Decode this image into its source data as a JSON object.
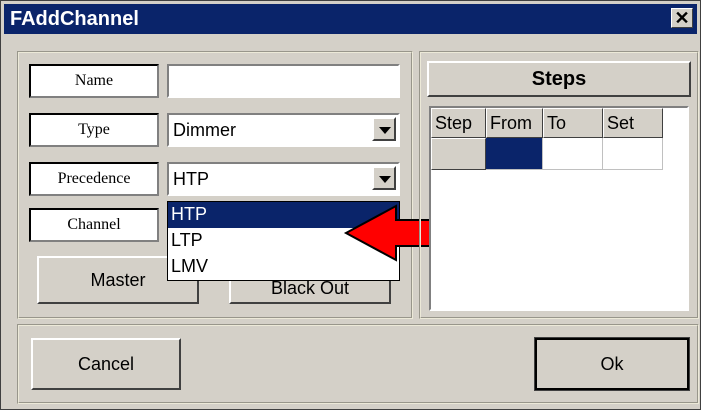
{
  "window": {
    "title": "FAddChannel",
    "close_symbol": "✕"
  },
  "form": {
    "name": {
      "label": "Name",
      "value": ""
    },
    "type": {
      "label": "Type",
      "value": "Dimmer"
    },
    "precedence": {
      "label": "Precedence",
      "value": "HTP",
      "options": [
        "HTP",
        "LTP",
        "LMV"
      ],
      "highlighted": "HTP"
    },
    "channel": {
      "label": "Channel"
    }
  },
  "buttons": {
    "master": "Master",
    "blackout": "Black Out",
    "cancel": "Cancel",
    "ok": "Ok"
  },
  "steps": {
    "title": "Steps",
    "columns": [
      "Step",
      "From",
      "To",
      "Set"
    ]
  },
  "colors": {
    "title_bar": "#0a246a",
    "selection": "#0a246a",
    "arrow": "#ff0000",
    "face": "#d4d0c8"
  }
}
